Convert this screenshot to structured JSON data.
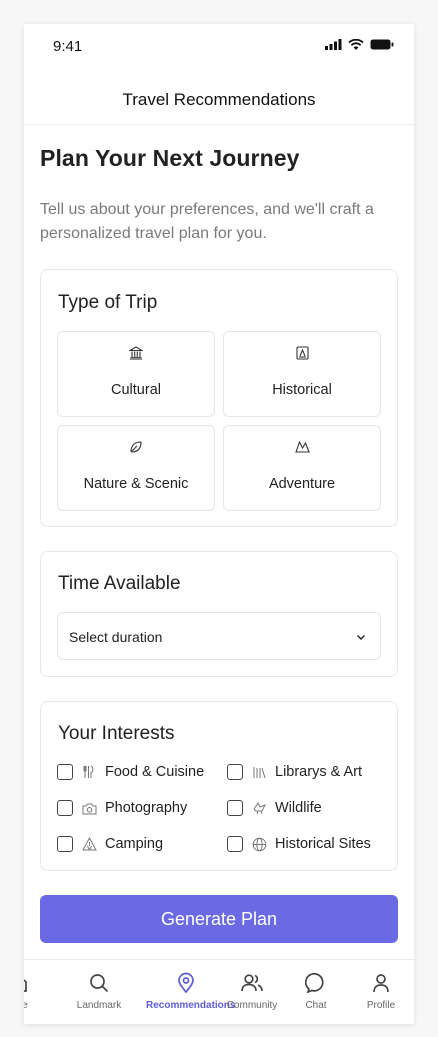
{
  "status": {
    "time": "9:41"
  },
  "header": {
    "title": "Travel Recommendations"
  },
  "intro": {
    "title": "Plan Your Next Journey",
    "subtitle": "Tell us about your preferences, and we'll craft a personalized travel plan for you."
  },
  "trip_type": {
    "title": "Type of Trip",
    "options": [
      {
        "label": "Cultural",
        "icon": "museum-icon"
      },
      {
        "label": "Historical",
        "icon": "monument-icon"
      },
      {
        "label": "Nature & Scenic",
        "icon": "leaf-icon"
      },
      {
        "label": "Adventure",
        "icon": "mountain-icon"
      }
    ]
  },
  "time_available": {
    "title": "Time Available",
    "select_value": "Select duration"
  },
  "interests": {
    "title": "Your Interests",
    "items": [
      {
        "label": "Food & Cuisine",
        "icon": "utensils-icon",
        "checked": false
      },
      {
        "label": "Librarys & Art",
        "icon": "library-icon",
        "checked": false
      },
      {
        "label": "Photography",
        "icon": "camera-icon",
        "checked": false
      },
      {
        "label": "Wildlife",
        "icon": "bird-icon",
        "checked": false
      },
      {
        "label": "Camping",
        "icon": "tent-icon",
        "checked": false
      },
      {
        "label": "Historical Sites",
        "icon": "globe-icon",
        "checked": false
      }
    ]
  },
  "generate_button": {
    "label": "Generate Plan"
  },
  "tabbar": {
    "items": [
      {
        "label": "Home",
        "visible_label": "ome",
        "icon": "home-icon"
      },
      {
        "label": "Landmark",
        "icon": "search-icon"
      },
      {
        "label": "Recommendations",
        "icon": "location-pin-icon",
        "active": true
      },
      {
        "label": "Community",
        "icon": "users-icon"
      },
      {
        "label": "Chat",
        "icon": "chat-bubble-icon"
      },
      {
        "label": "Profile",
        "icon": "user-icon"
      }
    ]
  },
  "colors": {
    "accent": "#6b69e4",
    "active_tab": "#5e5cd6"
  }
}
